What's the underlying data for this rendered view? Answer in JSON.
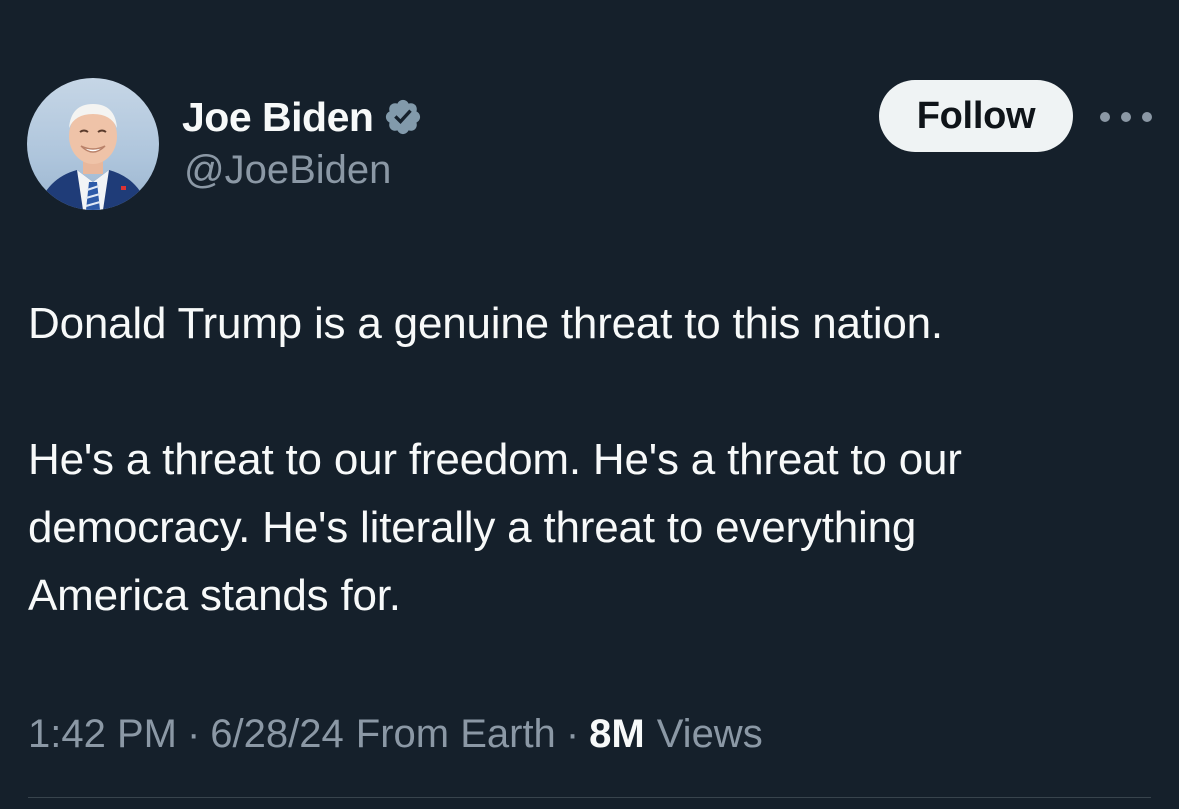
{
  "author": {
    "display_name": "Joe Biden",
    "handle": "@JoeBiden",
    "verified": true,
    "avatar_icon": "profile-photo"
  },
  "actions": {
    "follow_label": "Follow",
    "more_icon": "more-options-icon"
  },
  "tweet": {
    "paragraph_1": "Donald Trump is a genuine threat to this nation.",
    "paragraph_2_line_1": "He's a threat to our freedom. He's a threat to our",
    "paragraph_2_line_2": "democracy. He's literally a threat to everything",
    "paragraph_2_line_3": "America stands for."
  },
  "meta": {
    "time": "1:42 PM",
    "date": "6/28/24",
    "location": "From Earth",
    "separator": "·",
    "views_count": "8M",
    "views_label": "Views"
  },
  "colors": {
    "background": "#15202b",
    "primary_text": "#f7f9f9",
    "secondary_text": "#8b98a5",
    "verified_badge": "#829aab",
    "follow_button_bg": "#eff3f4",
    "follow_button_text": "#0f1419"
  }
}
